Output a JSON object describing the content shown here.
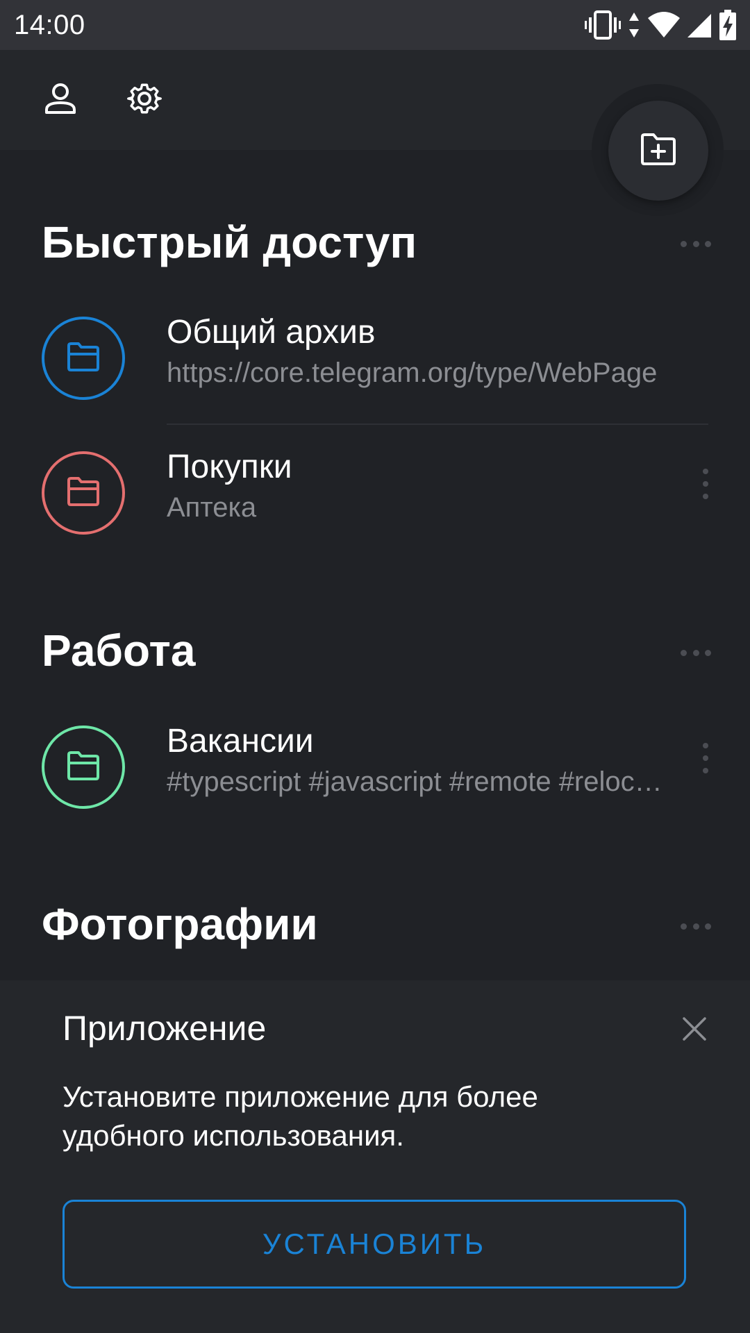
{
  "status_bar": {
    "time": "14:00",
    "icons": [
      "vibrate-icon",
      "data-arrows-icon",
      "wifi-icon",
      "cell-signal-icon",
      "battery-charging-icon"
    ]
  },
  "top_bar": {
    "icons": [
      "profile-icon",
      "settings-gear-icon",
      "add-folder-icon"
    ]
  },
  "sections": [
    {
      "title": "Быстрый доступ",
      "items": [
        {
          "name": "Общий архив",
          "description": "https://core.telegram.org/type/WebPage",
          "color": "#1a83d6"
        },
        {
          "name": "Покупки",
          "description": "Аптека",
          "color": "#e46f6f"
        }
      ]
    },
    {
      "title": "Работа",
      "items": [
        {
          "name": "Вакансии",
          "description": "#typescript #javascript #remote #relocation",
          "color": "#6ee7a8"
        }
      ]
    },
    {
      "title": "Фотографии",
      "items": []
    }
  ],
  "banner": {
    "title": "Приложение",
    "text": "Установите приложение для более удобного использования.",
    "button_label": "УСТАНОВИТЬ",
    "accent": "#1a83d6"
  }
}
